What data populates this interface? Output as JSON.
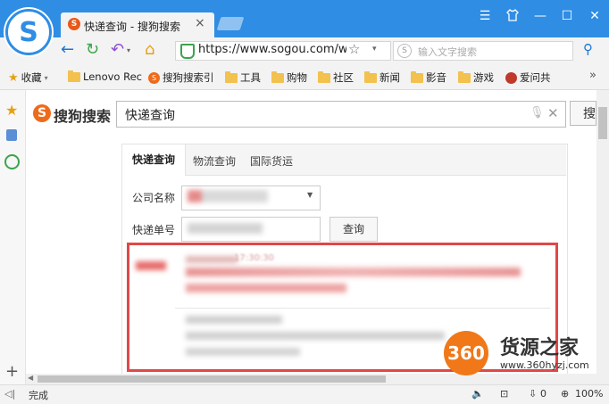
{
  "browser": {
    "tab_title": "快递查询 - 搜狗搜索",
    "tab_close": "×",
    "address": "https://www.sogou.com/we",
    "search_placeholder": "输入文字搜索",
    "logo_letter": "S",
    "window_controls": [
      "menu-icon",
      "skin-icon",
      "minimize-icon",
      "maximize-icon",
      "close-icon"
    ]
  },
  "bookmarks": [
    {
      "label": "收藏",
      "icon": "star-icon"
    },
    {
      "label": "Lenovo Rec",
      "icon": "folder-icon"
    },
    {
      "label": "搜狗搜索引",
      "icon": "sogou-icon"
    },
    {
      "label": "工具",
      "icon": "folder-icon"
    },
    {
      "label": "购物",
      "icon": "folder-icon"
    },
    {
      "label": "社区",
      "icon": "folder-icon"
    },
    {
      "label": "新闻",
      "icon": "folder-icon"
    },
    {
      "label": "影音",
      "icon": "folder-icon"
    },
    {
      "label": "游戏",
      "icon": "folder-icon"
    },
    {
      "label": "爱问共",
      "icon": "user-icon"
    }
  ],
  "sogou": {
    "logo_letter": "S",
    "logo_text": "搜狗搜索",
    "query": "快递查询",
    "search_button": "搜"
  },
  "express_widget": {
    "tabs": [
      "快递查询",
      "物流查询",
      "国际货运"
    ],
    "company_label": "公司名称",
    "number_label": "快递单号",
    "query_button": "查询",
    "result_time_visible": "17:30:30"
  },
  "status": {
    "text": "完成",
    "download_count": "0",
    "zoom": "100%"
  },
  "watermark": {
    "logo": "360",
    "brand": "货源之家",
    "url": "www.360hyzj.com"
  },
  "colors": {
    "titlebar": "#2f8de4",
    "highlight_border": "#e04848",
    "sogou_orange": "#ee6b1b",
    "watermark_orange": "#f07819"
  }
}
